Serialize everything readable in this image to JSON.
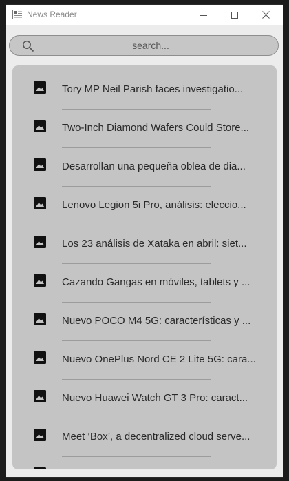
{
  "window": {
    "title": "News Reader"
  },
  "search": {
    "placeholder": "search..."
  },
  "articles": [
    {
      "title": "Tory MP Neil Parish faces investigatio...",
      "icon": "image-icon"
    },
    {
      "title": "Two-Inch Diamond Wafers Could Store...",
      "icon": "image-icon"
    },
    {
      "title": "Desarrollan una pequeña oblea de dia...",
      "icon": "image-icon"
    },
    {
      "title": "Lenovo Legion 5i Pro, análisis: eleccio...",
      "icon": "image-icon"
    },
    {
      "title": "Los 23 análisis de Xataka en abril: siet...",
      "icon": "image-icon"
    },
    {
      "title": "Cazando Gangas en móviles, tablets y ...",
      "icon": "image-icon"
    },
    {
      "title": "Nuevo POCO M4 5G: características y ...",
      "icon": "image-icon"
    },
    {
      "title": "Nuevo OnePlus Nord CE 2 Lite 5G: cara...",
      "icon": "image-icon"
    },
    {
      "title": "Nuevo Huawei Watch GT 3 Pro: caract...",
      "icon": "image-icon"
    },
    {
      "title": "Meet ‘Box’, a decentralized cloud serve...",
      "icon": "image-icon"
    }
  ]
}
